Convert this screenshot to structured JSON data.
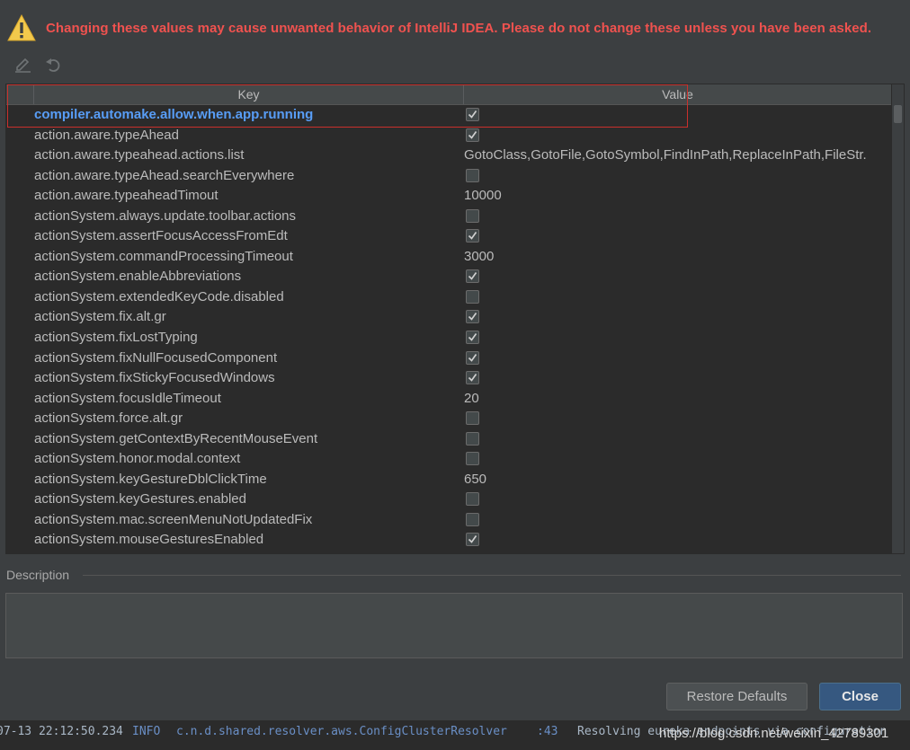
{
  "warning": {
    "text": "Changing these values may cause unwanted behavior of IntelliJ IDEA. Please do not change these unless you have been asked.",
    "icon": "warning-triangle-icon",
    "color": "#f0524f"
  },
  "toolbar": {
    "edit_icon": "edit-pencil-icon",
    "revert_icon": "undo-icon"
  },
  "table": {
    "headers": {
      "key": "Key",
      "value": "Value"
    },
    "rows": [
      {
        "key": "compiler.automake.allow.when.app.running",
        "type": "bool",
        "value": true,
        "selected": true
      },
      {
        "key": "action.aware.typeAhead",
        "type": "bool",
        "value": true
      },
      {
        "key": "action.aware.typeahead.actions.list",
        "type": "text",
        "value": "GotoClass,GotoFile,GotoSymbol,FindInPath,ReplaceInPath,FileStr."
      },
      {
        "key": "action.aware.typeAhead.searchEverywhere",
        "type": "bool",
        "value": false
      },
      {
        "key": "action.aware.typeaheadTimout",
        "type": "text",
        "value": "10000"
      },
      {
        "key": "actionSystem.always.update.toolbar.actions",
        "type": "bool",
        "value": false
      },
      {
        "key": "actionSystem.assertFocusAccessFromEdt",
        "type": "bool",
        "value": true
      },
      {
        "key": "actionSystem.commandProcessingTimeout",
        "type": "text",
        "value": "3000"
      },
      {
        "key": "actionSystem.enableAbbreviations",
        "type": "bool",
        "value": true
      },
      {
        "key": "actionSystem.extendedKeyCode.disabled",
        "type": "bool",
        "value": false
      },
      {
        "key": "actionSystem.fix.alt.gr",
        "type": "bool",
        "value": true
      },
      {
        "key": "actionSystem.fixLostTyping",
        "type": "bool",
        "value": true
      },
      {
        "key": "actionSystem.fixNullFocusedComponent",
        "type": "bool",
        "value": true
      },
      {
        "key": "actionSystem.fixStickyFocusedWindows",
        "type": "bool",
        "value": true
      },
      {
        "key": "actionSystem.focusIdleTimeout",
        "type": "text",
        "value": "20"
      },
      {
        "key": "actionSystem.force.alt.gr",
        "type": "bool",
        "value": false
      },
      {
        "key": "actionSystem.getContextByRecentMouseEvent",
        "type": "bool",
        "value": false
      },
      {
        "key": "actionSystem.honor.modal.context",
        "type": "bool",
        "value": false
      },
      {
        "key": "actionSystem.keyGestureDblClickTime",
        "type": "text",
        "value": "650"
      },
      {
        "key": "actionSystem.keyGestures.enabled",
        "type": "bool",
        "value": false
      },
      {
        "key": "actionSystem.mac.screenMenuNotUpdatedFix",
        "type": "bool",
        "value": false
      },
      {
        "key": "actionSystem.mouseGesturesEnabled",
        "type": "bool",
        "value": true
      }
    ]
  },
  "description": {
    "label": "Description",
    "text": ""
  },
  "buttons": {
    "restore": "Restore Defaults",
    "close": "Close"
  },
  "console": {
    "time": "07-13 22:12:50.234",
    "level": "INFO",
    "class": "c.n.d.shared.resolver.aws.ConfigClusterResolver",
    "line": ":43",
    "message": "Resolving eureka endpoints via configuration",
    "watermark": "https://blog.csdn.net/weixin_42789301"
  }
}
